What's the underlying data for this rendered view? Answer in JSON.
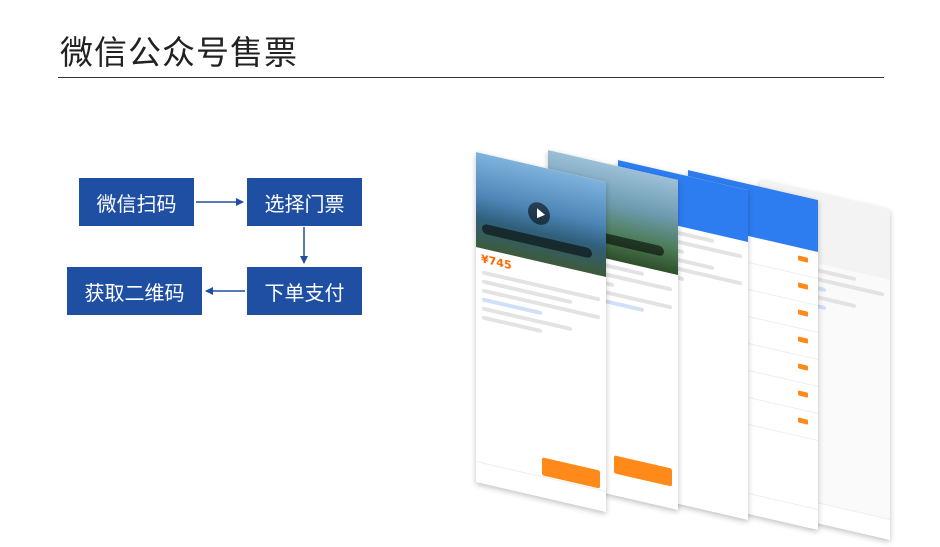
{
  "page": {
    "title": "微信公众号售票"
  },
  "flow": {
    "step1": "微信扫码",
    "step2": "选择门票",
    "step3": "下单支付",
    "step4": "获取二维码",
    "box_color": "#1f4fa3",
    "arrow_color": "#1f4fa3"
  },
  "phone_stack": {
    "description_icons": [
      "phone-screenshot"
    ]
  }
}
